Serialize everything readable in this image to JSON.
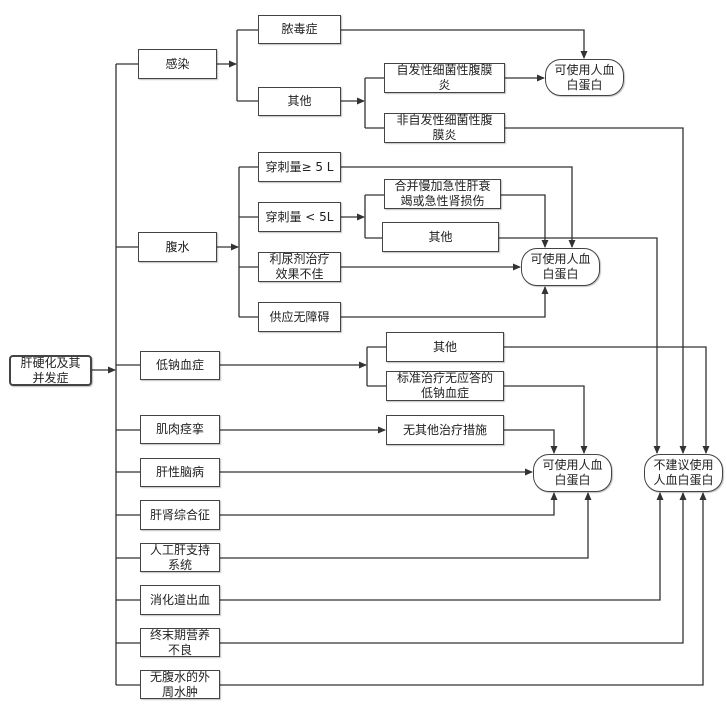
{
  "root": "肝硬化及其\n并发症",
  "infection": {
    "label": "感染",
    "sepsis": "脓毒症",
    "other": "其他",
    "sbp": "自发性细菌性腹膜\n炎",
    "non_sbp": "非自发性细菌性腹\n膜炎",
    "outcome": "可使用人血\n白蛋白"
  },
  "ascites": {
    "label": "腹水",
    "large_paracentesis": "穿刺量≥ 5 L",
    "small_paracentesis": "穿刺量 < 5L",
    "aclf_aki": "合并慢加急性肝衰\n竭或急性肾损伤",
    "other": "其他",
    "diuretic_poor": "利尿剂治疗\n效果不佳",
    "supply_ok": "供应无障碍",
    "outcome": "可使用人血\n白蛋白"
  },
  "hyponatremia": {
    "label": "低钠血症",
    "other": "其他",
    "refractory": "标准治疗无应答的\n低钠血症"
  },
  "cramps": {
    "label": "肌肉痉挛",
    "no_other_treatment": "无其他治疗措施"
  },
  "others": {
    "hepatic_encephalopathy": "肝性脑病",
    "hepatorenal": "肝肾综合征",
    "artificial_liver": "人工肝支持\n系统",
    "gi_bleeding": "消化道出血",
    "malnutrition": "终末期营养\n不良",
    "edema": "无腹水的外\n周水肿"
  },
  "outcomes": {
    "use_albumin": "可使用人血\n白蛋白",
    "not_recommended": "不建议使用\n人血白蛋白"
  }
}
